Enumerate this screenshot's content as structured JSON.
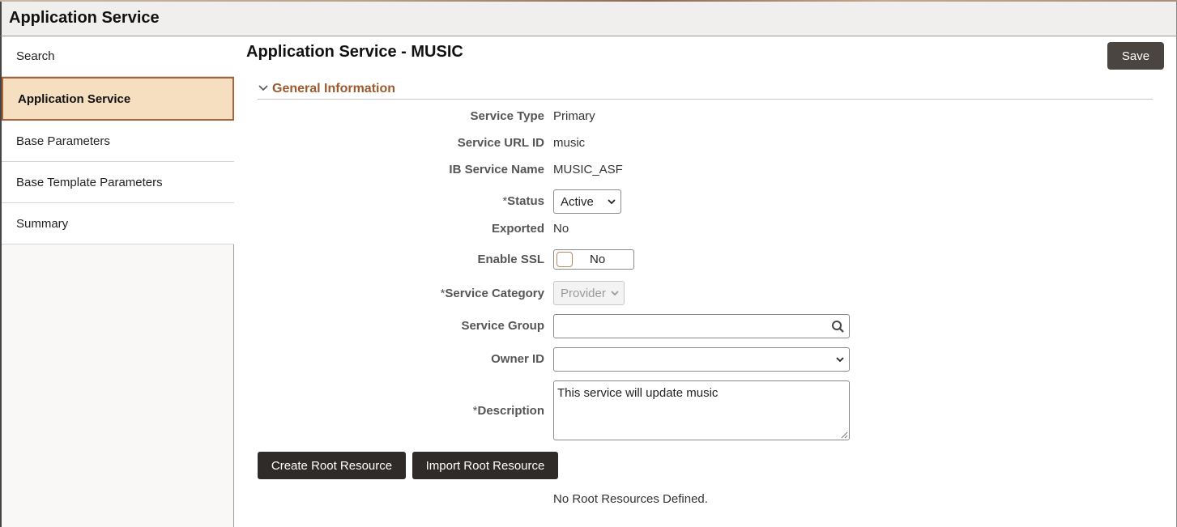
{
  "app": {
    "title": "Application Service"
  },
  "sidebar": {
    "items": [
      {
        "label": "Search",
        "active": false
      },
      {
        "label": "Application Service",
        "active": true
      },
      {
        "label": "Base Parameters",
        "active": false
      },
      {
        "label": "Base Template Parameters",
        "active": false
      },
      {
        "label": "Summary",
        "active": false
      }
    ]
  },
  "main": {
    "title": "Application Service - MUSIC",
    "save_label": "Save",
    "section": {
      "label": "General Information",
      "icon": "chevron-down-icon"
    },
    "fields": {
      "service_type": {
        "label": "Service Type",
        "value": "Primary"
      },
      "service_url_id": {
        "label": "Service URL ID",
        "value": "music"
      },
      "ib_service_name": {
        "label": "IB Service Name",
        "value": "MUSIC_ASF"
      },
      "status": {
        "required": "*",
        "label": "Status",
        "value": "Active"
      },
      "exported": {
        "label": "Exported",
        "value": "No"
      },
      "enable_ssl": {
        "label": "Enable SSL",
        "value": "No"
      },
      "service_category": {
        "required": "*",
        "label": "Service Category",
        "value": "Provider"
      },
      "service_group": {
        "label": "Service Group",
        "value": "",
        "icon": "search-icon"
      },
      "owner_id": {
        "label": "Owner ID",
        "value": ""
      },
      "description": {
        "required": "*",
        "label": "Description",
        "value": "This service will update music"
      }
    },
    "buttons": {
      "create_root": "Create Root Resource",
      "import_root": "Import Root Resource"
    },
    "empty_message": "No Root Resources Defined."
  },
  "colors": {
    "accent": "#9b5a2f",
    "active_nav_bg": "#f5dfc0",
    "active_nav_border": "#a9633a",
    "dark_button": "#2f2b29",
    "save_button": "#4a4541"
  }
}
